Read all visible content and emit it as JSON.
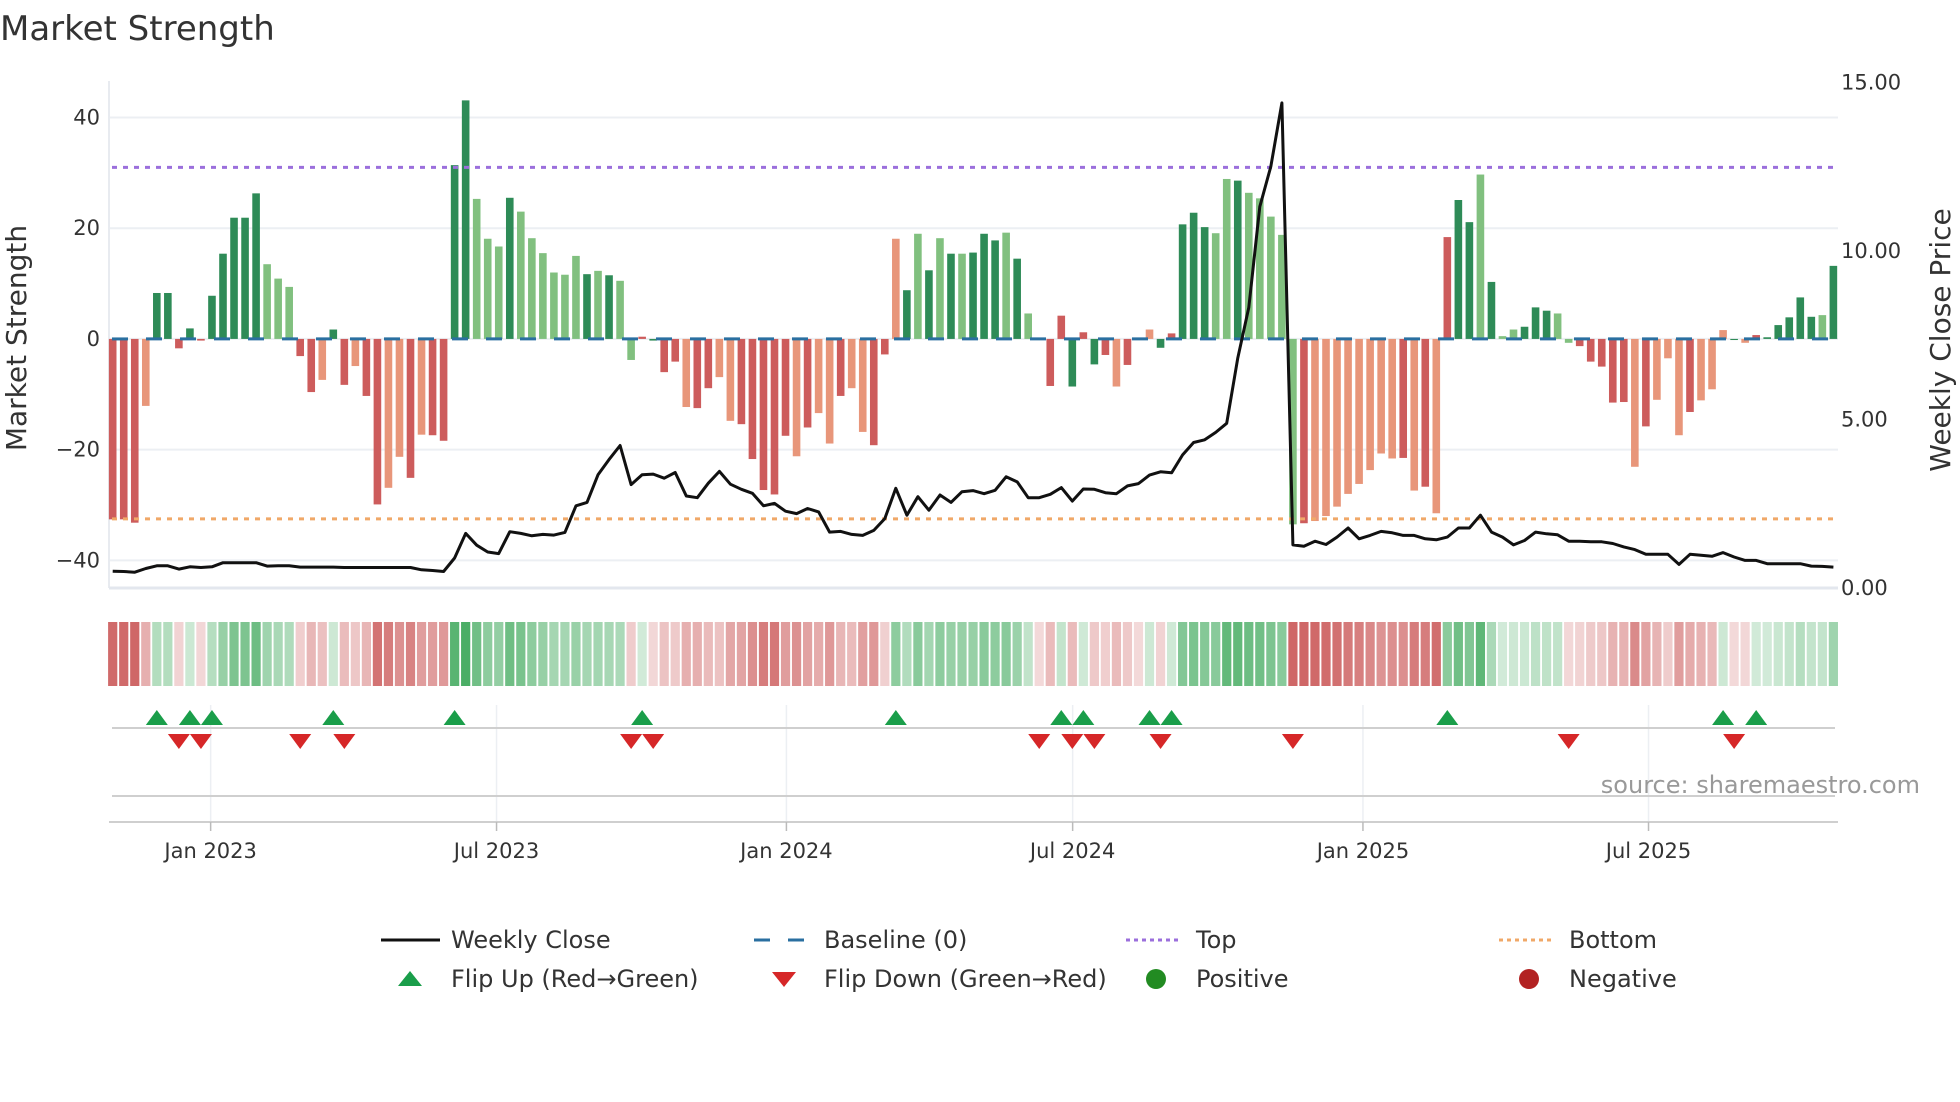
{
  "title": "Market Strength",
  "source": "source: sharemaestro.com",
  "legend": {
    "weekly_close": "Weekly Close",
    "baseline": "Baseline (0)",
    "top": "Top",
    "bottom": "Bottom",
    "flip_up": "Flip Up (Red→Green)",
    "flip_down": "Flip Down (Green→Red)",
    "positive": "Positive",
    "negative": "Negative"
  },
  "colors": {
    "strong_positive": "#2e8b57",
    "weak_positive": "#81c07f",
    "strong_negative": "#cd5c5c",
    "weak_negative": "#e8967a",
    "price_line": "#111111",
    "baseline": "#2a6fa0",
    "top": "#9b6fdc",
    "bottom": "#f0a868",
    "flip_up": "#1a9e4a",
    "flip_down": "#d62728",
    "positive": "#228b22",
    "negative": "#b22222"
  },
  "chart_data": {
    "type": "bar",
    "title": "Market Strength",
    "ylabel": "Market Strength",
    "y2label": "Weekly Close Price",
    "xlabel": "",
    "frequency": "weekly",
    "ylim": [
      -45,
      46.6
    ],
    "y2lim": [
      0,
      15.05
    ],
    "top_level": 31,
    "bottom_level": -32.5,
    "baseline": 0,
    "yticks": [
      {
        "v": 40,
        "label": "40"
      },
      {
        "v": 20,
        "label": "20"
      },
      {
        "v": 0,
        "label": "0"
      },
      {
        "v": -20,
        "label": "−20"
      },
      {
        "v": -40,
        "label": "−40"
      }
    ],
    "y2ticks": [
      {
        "v": 15,
        "label": "15.00"
      },
      {
        "v": 10,
        "label": "10.00"
      },
      {
        "v": 5,
        "label": "5.00"
      },
      {
        "v": 0,
        "label": "0.00"
      }
    ],
    "xticks": [
      {
        "week": 8.88,
        "label": "Jan 2023"
      },
      {
        "week": 34.8,
        "label": "Jul 2023"
      },
      {
        "week": 61.08,
        "label": "Jan 2024"
      },
      {
        "week": 87.03,
        "label": "Jul 2024"
      },
      {
        "week": 113.35,
        "label": "Jan 2025"
      },
      {
        "week": 139.24,
        "label": "Jul 2025"
      }
    ],
    "strength": [
      -32.6,
      -32.6,
      -33.2,
      -12.1,
      8.3,
      8.3,
      -1.7,
      1.9,
      -0.3,
      7.8,
      15.4,
      21.9,
      21.9,
      26.3,
      13.5,
      10.9,
      9.4,
      -3.1,
      -9.6,
      -7.4,
      1.7,
      -8.3,
      -4.9,
      -10.3,
      -29.9,
      -26.9,
      -21.3,
      -25.1,
      -17.3,
      -17.4,
      -18.4,
      31.4,
      43.1,
      25.3,
      18.1,
      16.7,
      25.5,
      23.0,
      18.2,
      15.5,
      12.0,
      11.6,
      15.0,
      11.7,
      12.3,
      11.5,
      10.5,
      -3.8,
      0.4,
      -0.3,
      -6.0,
      -4.1,
      -12.3,
      -12.5,
      -8.9,
      -6.9,
      -14.8,
      -15.4,
      -21.7,
      -27.3,
      -28.1,
      -17.5,
      -21.2,
      -16.0,
      -13.4,
      -18.9,
      -10.3,
      -8.9,
      -16.8,
      -19.2,
      -2.8,
      18.1,
      8.8,
      19.0,
      12.4,
      18.2,
      15.4,
      15.4,
      15.6,
      19.0,
      17.8,
      19.2,
      14.5,
      4.6,
      -0.2,
      -8.5,
      4.2,
      -8.6,
      1.2,
      -4.6,
      -2.9,
      -8.6,
      -4.7,
      -0.2,
      1.7,
      -1.6,
      1.0,
      20.7,
      22.8,
      20.2,
      19.1,
      28.9,
      28.6,
      26.4,
      25.4,
      22.1,
      18.8,
      -33.5,
      -33.3,
      -32.9,
      -32.0,
      -30.3,
      -28.0,
      -26.2,
      -23.7,
      -20.7,
      -21.6,
      -21.5,
      -27.4,
      -26.7,
      -31.5,
      18.4,
      25.1,
      21.1,
      29.7,
      10.3,
      0.5,
      1.7,
      2.2,
      5.7,
      5.1,
      4.6,
      -0.7,
      -1.3,
      -4.1,
      -5.0,
      -11.5,
      -11.4,
      -23.1,
      -15.8,
      -11.0,
      -3.5,
      -17.4,
      -13.2,
      -11.1,
      -9.1,
      1.6,
      -0.2,
      -0.7,
      0.7,
      0.3,
      2.5,
      3.9,
      7.5,
      4.0,
      4.3,
      13.2
    ],
    "strength_shade": "RRRrGGRGRGGGGGgggRRrGRrRRrrRrRRGGgggGggggggGgGggRGRRrRRrrRRRRRrRrrRrrRRrGgGgGgGGGgGggRRGRGRrRrrGRGGGggGgggggRrrrrrrrrRrRrRGGgGggGGGggRRRRRrRrrrRrrrGrRGGGGGgGG",
    "weekly_close": [
      0.5,
      0.49,
      0.47,
      0.58,
      0.66,
      0.66,
      0.56,
      0.63,
      0.61,
      0.63,
      0.75,
      0.75,
      0.75,
      0.75,
      0.65,
      0.66,
      0.66,
      0.62,
      0.62,
      0.62,
      0.62,
      0.61,
      0.61,
      0.61,
      0.61,
      0.61,
      0.61,
      0.61,
      0.54,
      0.52,
      0.49,
      0.89,
      1.62,
      1.27,
      1.07,
      1.02,
      1.67,
      1.62,
      1.55,
      1.59,
      1.57,
      1.65,
      2.44,
      2.54,
      3.36,
      3.81,
      4.23,
      3.07,
      3.36,
      3.38,
      3.26,
      3.43,
      2.73,
      2.68,
      3.11,
      3.46,
      3.08,
      2.93,
      2.81,
      2.44,
      2.51,
      2.28,
      2.21,
      2.36,
      2.26,
      1.66,
      1.68,
      1.59,
      1.56,
      1.71,
      2.06,
      2.96,
      2.16,
      2.71,
      2.31,
      2.76,
      2.54,
      2.86,
      2.89,
      2.8,
      2.9,
      3.3,
      3.15,
      2.68,
      2.68,
      2.78,
      2.98,
      2.58,
      2.94,
      2.93,
      2.83,
      2.8,
      3.03,
      3.1,
      3.35,
      3.45,
      3.42,
      3.95,
      4.32,
      4.4,
      4.62,
      4.89,
      6.83,
      8.33,
      11.32,
      12.51,
      14.4,
      1.28,
      1.24,
      1.39,
      1.29,
      1.51,
      1.78,
      1.46,
      1.56,
      1.68,
      1.64,
      1.56,
      1.56,
      1.46,
      1.43,
      1.51,
      1.78,
      1.78,
      2.16,
      1.66,
      1.51,
      1.28,
      1.41,
      1.66,
      1.61,
      1.58,
      1.39,
      1.39,
      1.37,
      1.37,
      1.32,
      1.22,
      1.14,
      1.0,
      1.0,
      1.0,
      0.7,
      1.0,
      0.97,
      0.94,
      1.05,
      0.92,
      0.82,
      0.82,
      0.72,
      0.72,
      0.72,
      0.72,
      0.65,
      0.64,
      0.62
    ],
    "flip_up_weeks": [
      4,
      7,
      9,
      20,
      31,
      48,
      71,
      86,
      88,
      94,
      96,
      121,
      146,
      149
    ],
    "flip_down_weeks": [
      6,
      8,
      17,
      21,
      47,
      49,
      84,
      87,
      89,
      95,
      107,
      132,
      147
    ],
    "legend_position": "bottom"
  }
}
